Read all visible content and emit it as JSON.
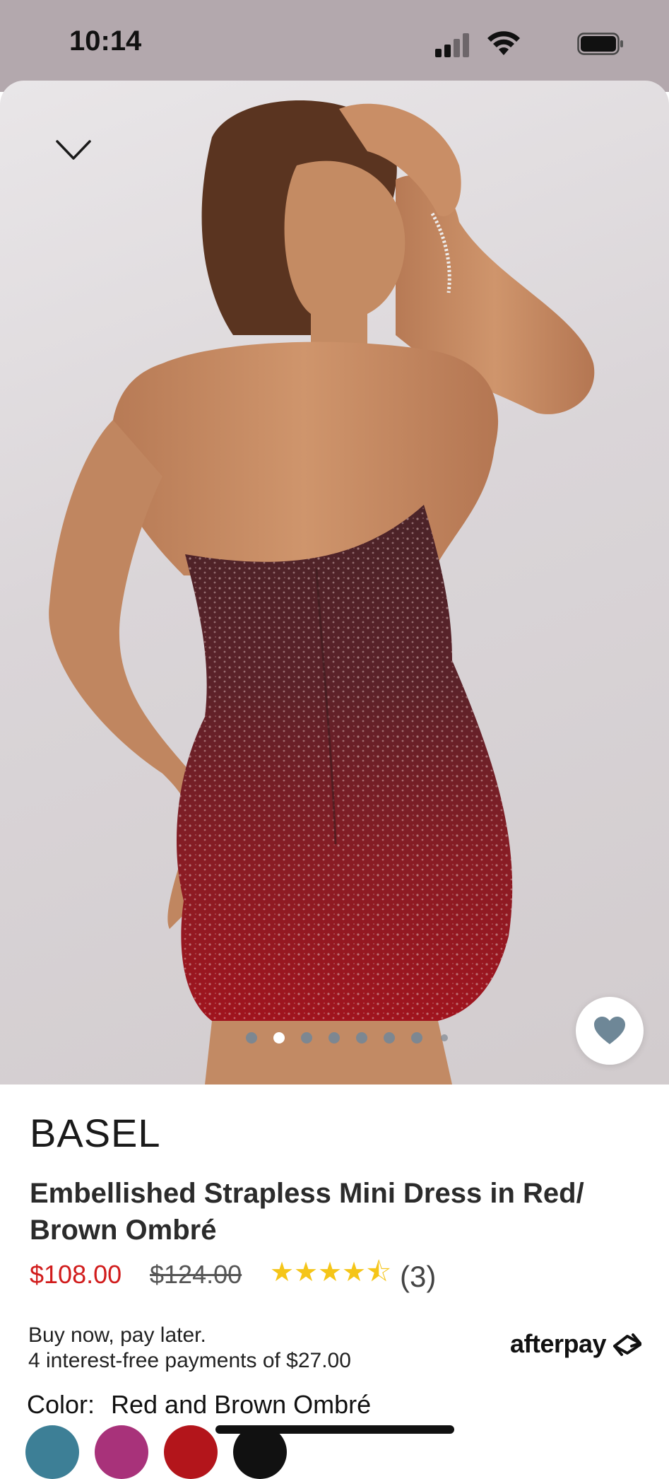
{
  "status_bar": {
    "time": "10:14",
    "icons": [
      "cellular-signal-icon",
      "wifi-icon",
      "battery-icon"
    ]
  },
  "gallery": {
    "image_count": 8,
    "active_index": 1,
    "favorite_icon": "heart-icon",
    "back_icon": "chevron-down-icon"
  },
  "product": {
    "brand": "BASEL",
    "title": "Embellished Strapless Mini Dress in Red/ Brown Ombré",
    "price_sale": "$108.00",
    "price_original": "$124.00",
    "rating_stars": 4.5,
    "rating_count": "(3)"
  },
  "bnpl": {
    "line1": "Buy now, pay later.",
    "line2": "4 interest-free payments of $27.00",
    "provider": "afterpay"
  },
  "color": {
    "label": "Color:",
    "selected": "Red and Brown Ombré",
    "swatches": [
      {
        "color": "#3d7f96"
      },
      {
        "color": "#a8327a"
      },
      {
        "color": "#b3151b"
      },
      {
        "color": "#111111"
      }
    ]
  },
  "colors": {
    "status_bar_bg": "#b3a8ad",
    "sale_price": "#d11c1c",
    "star": "#f5c518",
    "heart": "#6e8797"
  }
}
